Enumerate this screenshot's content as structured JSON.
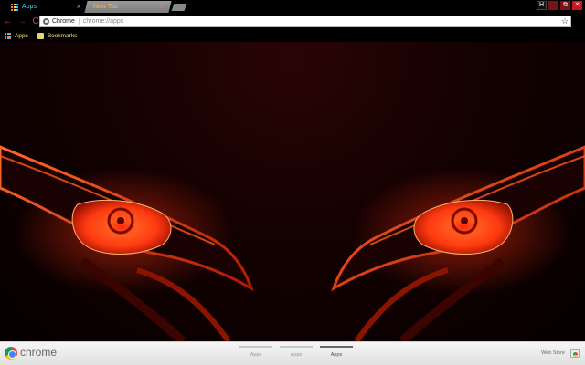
{
  "tabs": [
    {
      "title": "Apps",
      "active": true
    },
    {
      "title": "New Tab",
      "active": false
    }
  ],
  "window": {
    "user_initial": "H",
    "minimize": "–",
    "maximize": "⧉",
    "close": "✕"
  },
  "toolbar": {
    "back": "←",
    "forward": "→",
    "reload": "C",
    "chip_label": "Chrome",
    "url": "chrome://apps",
    "star": "☆",
    "menu": "⋮"
  },
  "bookmarks": [
    {
      "label": "Apps",
      "icon": "apps-grid-icon"
    },
    {
      "label": "Bookmarks",
      "icon": "folder-icon"
    }
  ],
  "footer": {
    "brand": "chrome",
    "pages": [
      {
        "label": "Apps",
        "current": false
      },
      {
        "label": "Apps",
        "current": false
      },
      {
        "label": "Apps",
        "current": true
      }
    ],
    "webstore_label": "Web Store"
  },
  "colors": {
    "accent": "#e23a3a",
    "eye_glow": "#ff4a1a",
    "background": "#0a0000"
  }
}
